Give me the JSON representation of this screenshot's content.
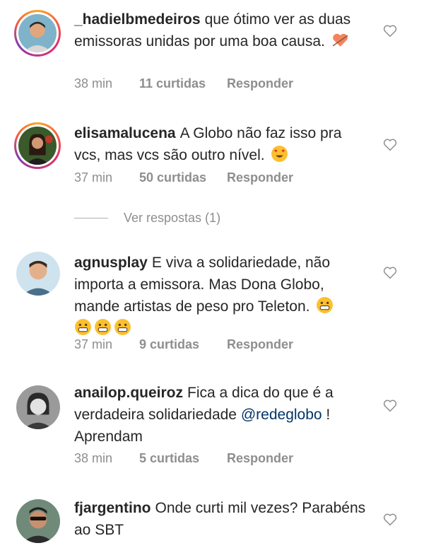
{
  "comments": [
    {
      "username": "_hadielbmedeiros",
      "text": "que ótimo ver as duas emissoras unidas por uma boa causa.",
      "emojis": [
        "heart-arrow-emoji"
      ],
      "time": "38 min",
      "likes": "11 curtidas",
      "reply": "Responder",
      "story_ring": true
    },
    {
      "username": "elisamalucena",
      "text": "A Globo não faz isso pra vcs, mas vcs são outro nível.",
      "emojis": [
        "heart-eyes-emoji"
      ],
      "time": "37 min",
      "likes": "50 curtidas",
      "reply": "Responder",
      "story_ring": true
    },
    {
      "username": "agnusplay",
      "text": "E viva a solidariedade, não importa a emissora. Mas Dona Globo, mande artistas de peso pro Teleton.",
      "emojis": [
        "grin-emoji",
        "grin-emoji",
        "grin-emoji",
        "grin-emoji"
      ],
      "time": "37 min",
      "likes": "9 curtidas",
      "reply": "Responder",
      "story_ring": false
    },
    {
      "username": "anailop.queiroz",
      "text_before": "Fica a dica do que é a verdadeira solidariedade",
      "mention": "@redeglobo",
      "text_after": "! Aprendam",
      "time": "38 min",
      "likes": "5 curtidas",
      "reply": "Responder",
      "story_ring": false
    },
    {
      "username": "fjargentino",
      "text": "Onde curti mil vezes? Parabéns ao SBT",
      "story_ring": false
    }
  ],
  "view_replies": "Ver respostas (1)",
  "icons": {
    "like": "heart-outline-icon"
  },
  "colors": {
    "text": "#262626",
    "meta": "#8e8e8e",
    "mention": "#003569"
  }
}
